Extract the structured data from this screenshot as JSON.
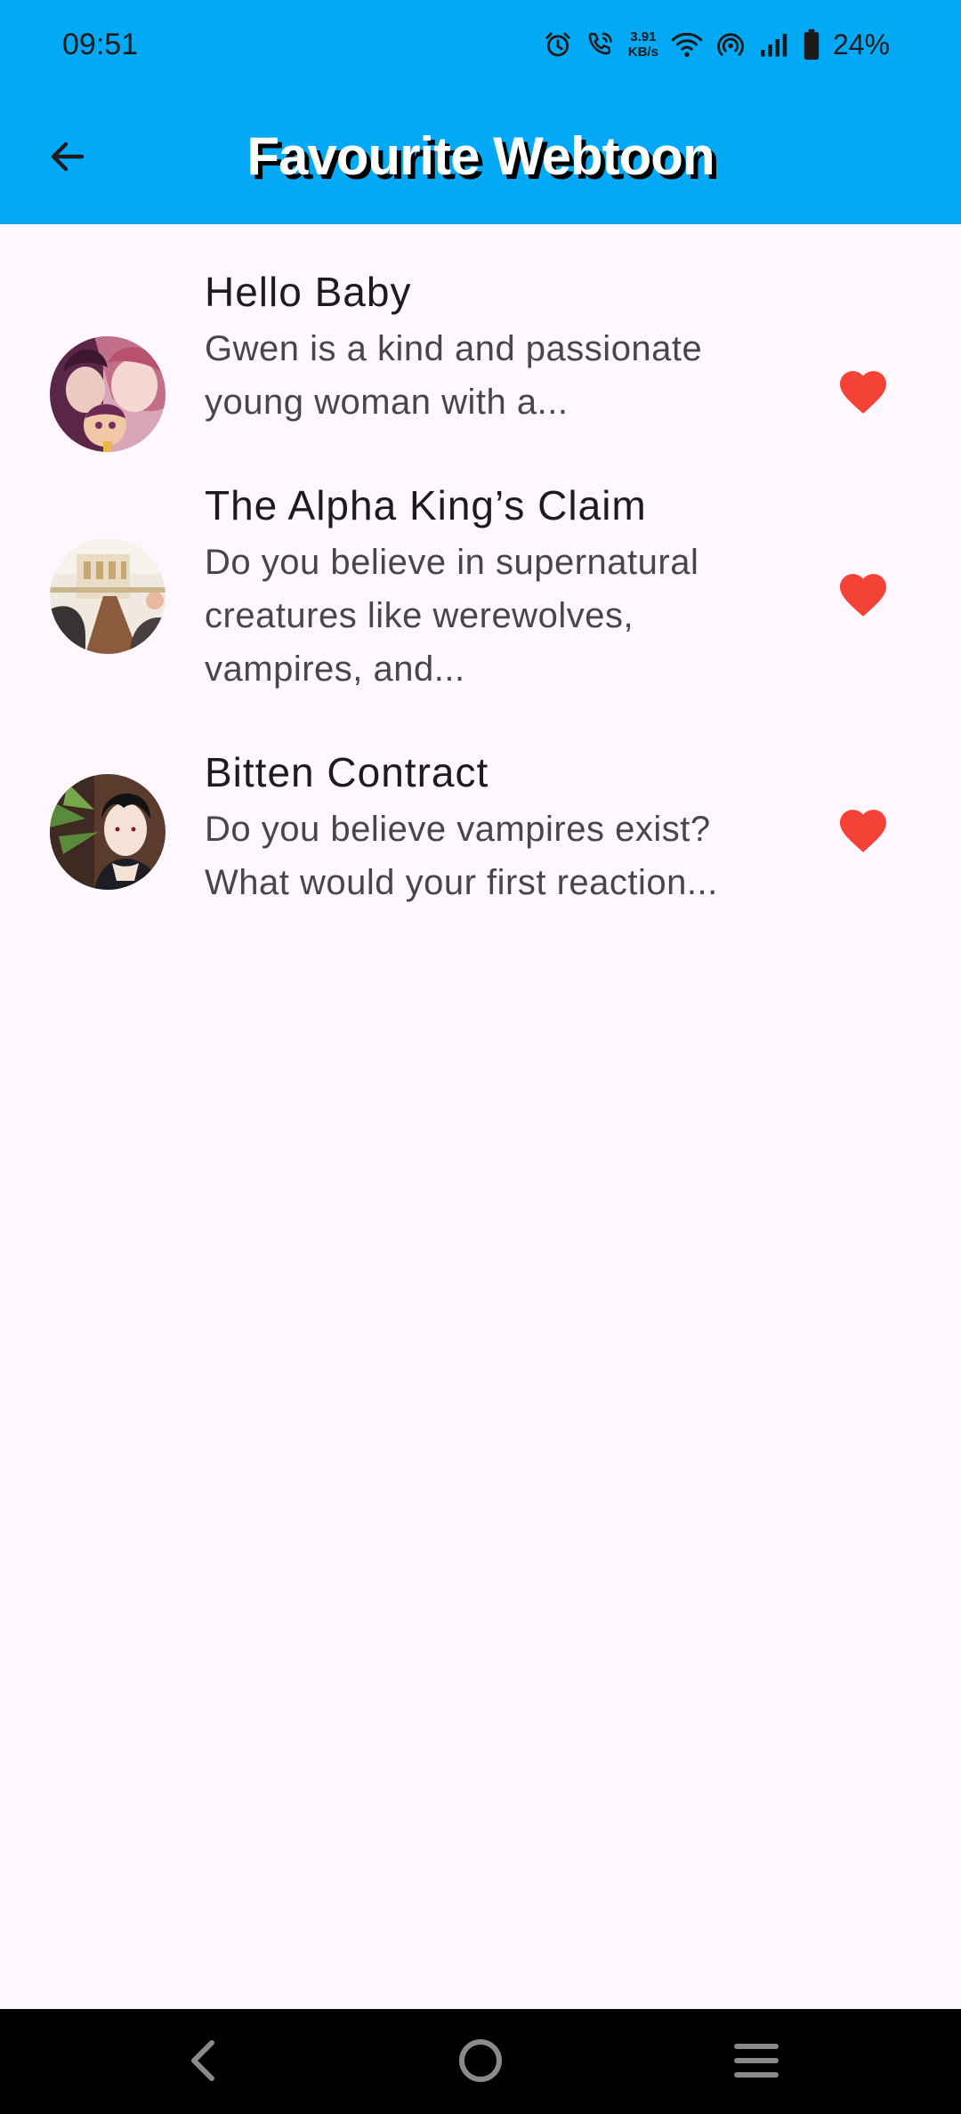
{
  "status_bar": {
    "time": "09:51",
    "net_speed_value": "3.91",
    "net_speed_unit": "KB/s",
    "battery": "24%",
    "icons": [
      "alarm-icon",
      "wifi-call-icon",
      "wifi-icon",
      "hotspot-icon",
      "signal-icon",
      "battery-icon"
    ]
  },
  "app_bar": {
    "title": "Favourite Webtoon",
    "back_icon": "arrow-left-icon",
    "background_color": "#03A9F4"
  },
  "favourites": [
    {
      "title": "Hello Baby",
      "description": "Gwen is a kind and passionate young woman with a...",
      "favourite_icon": "heart-icon"
    },
    {
      "title": "The Alpha King’s Claim",
      "description": "Do you believe in supernatural creatures like werewolves, vampires, and...",
      "favourite_icon": "heart-icon"
    },
    {
      "title": "Bitten Contract",
      "description": "Do you believe vampires exist? What would your first reaction...",
      "favourite_icon": "heart-icon"
    }
  ],
  "colors": {
    "heart": "#F44336",
    "page_background": "#FEF7FF"
  },
  "nav_bar": {
    "buttons": [
      "back-nav-icon",
      "home-nav-icon",
      "recents-nav-icon"
    ]
  }
}
